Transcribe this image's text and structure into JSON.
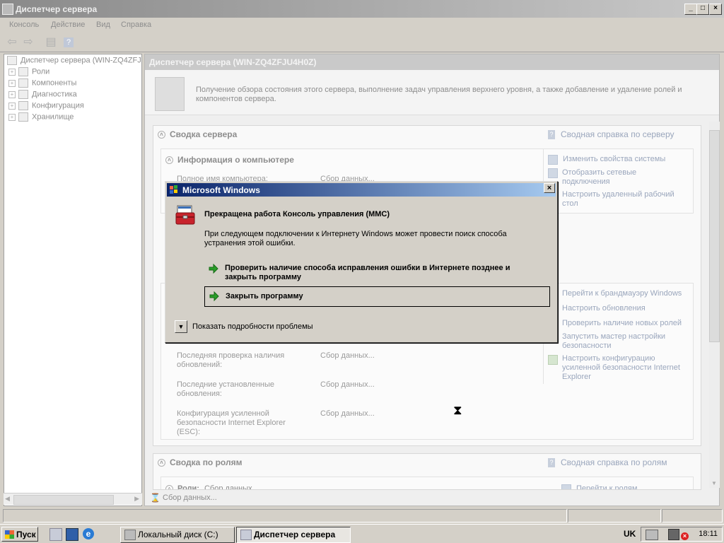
{
  "window": {
    "title": "Диспетчер сервера",
    "controls": {
      "minimize": "_",
      "restore": "□",
      "close": "×"
    }
  },
  "menu": [
    "Консоль",
    "Действие",
    "Вид",
    "Справка"
  ],
  "tree": {
    "root": "Диспетчер сервера (WIN-ZQ4ZFJ",
    "items": [
      "Роли",
      "Компоненты",
      "Диагностика",
      "Конфигурация",
      "Хранилище"
    ]
  },
  "content": {
    "header": "Диспетчер сервера (WIN-ZQ4ZFJU4H0Z)",
    "intro": "Получение обзора состояния этого сервера, выполнение задач управления верхнего уровня, а также добавление и удаление ролей и компонентов сервера.",
    "server_summary": {
      "title": "Сводка сервера",
      "help": "Сводная справка по серверу",
      "computer_info": {
        "title": "Информация о компьютере",
        "rows": [
          {
            "label": "Полное имя компьютера:",
            "value": "Сбор данных..."
          }
        ],
        "links": [
          "Изменить свойства системы",
          "Отобразить сетевые подключения",
          "Настроить удаленный рабочий стол"
        ]
      },
      "security": {
        "rows": [
          {
            "label": "Последняя проверка наличия обновлений:",
            "value": "Сбор данных..."
          },
          {
            "label": "Последние установленные обновления:",
            "value": "Сбор данных..."
          },
          {
            "label": "Конфигурация усиленной безопасности Internet Explorer (ESC):",
            "value": "Сбор данных..."
          }
        ],
        "links": [
          "Перейти к брандмауэру Windows",
          "Настроить обновления",
          "Проверить наличие новых ролей",
          "Запустить мастер настройки безопасности",
          "Настроить конфигурацию усиленной безопасности Internet Explorer"
        ]
      }
    },
    "roles_summary": {
      "title": "Сводка по ролям",
      "help": "Сводная справка по ролям",
      "row_label": "Роли:",
      "row_value": "Сбор данных",
      "link": "Перейти к ролям"
    }
  },
  "status": {
    "text": "Сбор данных..."
  },
  "dialog": {
    "title": "Microsoft Windows",
    "heading": "Прекращена работа Консоль управления (MMC)",
    "body": "При следующем подключении к Интернету Windows может провести поиск способа устранения этой ошибки.",
    "option_check": "Проверить наличие способа исправления ошибки в Интернете позднее и закрыть программу",
    "option_close": "Закрыть программу",
    "details": "Показать подробности проблемы"
  },
  "taskbar": {
    "start": "Пуск",
    "tasks": [
      "Локальный диск (C:)",
      "Диспетчер сервера"
    ],
    "language": "UK",
    "clock": "18:11"
  },
  "colors": {
    "dialog_title_start": "#0a246a",
    "dialog_title_end": "#a6caf0",
    "arrow_green": "#2a9d2a",
    "link_dimmed": "#9aa6bc"
  }
}
